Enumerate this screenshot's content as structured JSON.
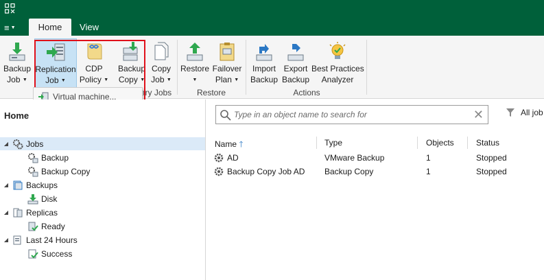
{
  "menu": {
    "label": "≡"
  },
  "tabs": [
    {
      "label": "Home"
    },
    {
      "label": "View"
    }
  ],
  "ribbon": {
    "buttons": {
      "backup_job": {
        "line1": "Backup",
        "line2": "Job"
      },
      "replication_job": {
        "line1": "Replication",
        "line2": "Job"
      },
      "cdp_policy": {
        "line1": "CDP",
        "line2": "Policy"
      },
      "backup_copy": {
        "line1": "Backup",
        "line2": "Copy"
      },
      "copy_job": {
        "line1": "Copy",
        "line2": "Job"
      },
      "restore": {
        "line1": "Restore",
        "line2": ""
      },
      "failover_plan": {
        "line1": "Failover",
        "line2": "Plan"
      },
      "import_backup": {
        "line1": "Import",
        "line2": "Backup"
      },
      "export_backup": {
        "line1": "Export",
        "line2": "Backup"
      },
      "best_practices": {
        "line1": "Best Practices",
        "line2": "Analyzer"
      }
    },
    "groups": {
      "secondary_jobs": "ary Jobs",
      "restore": "Restore",
      "actions": "Actions"
    },
    "dropdown": {
      "item": "Virtual machine..."
    }
  },
  "left_pane": {
    "title": "Home",
    "tree": [
      {
        "label": "Jobs"
      },
      {
        "label": "Backup"
      },
      {
        "label": "Backup Copy"
      },
      {
        "label": "Backups"
      },
      {
        "label": "Disk"
      },
      {
        "label": "Replicas"
      },
      {
        "label": "Ready"
      },
      {
        "label": "Last 24 Hours"
      },
      {
        "label": "Success"
      }
    ]
  },
  "right_pane": {
    "search_placeholder": "Type in an object name to search for",
    "filter_label": "All job",
    "columns": {
      "name": "Name",
      "type": "Type",
      "objects": "Objects",
      "status": "Status"
    },
    "rows": [
      {
        "name": "AD",
        "type": "VMware Backup",
        "objects": "1",
        "status": "Stopped"
      },
      {
        "name": "Backup Copy Job AD",
        "type": "Backup Copy",
        "objects": "1",
        "status": "Stopped"
      }
    ]
  },
  "colors": {
    "brand": "#00603a",
    "accent_green": "#2fa84f",
    "selection": "#c7e2f5",
    "highlight_box": "#e0101a"
  }
}
